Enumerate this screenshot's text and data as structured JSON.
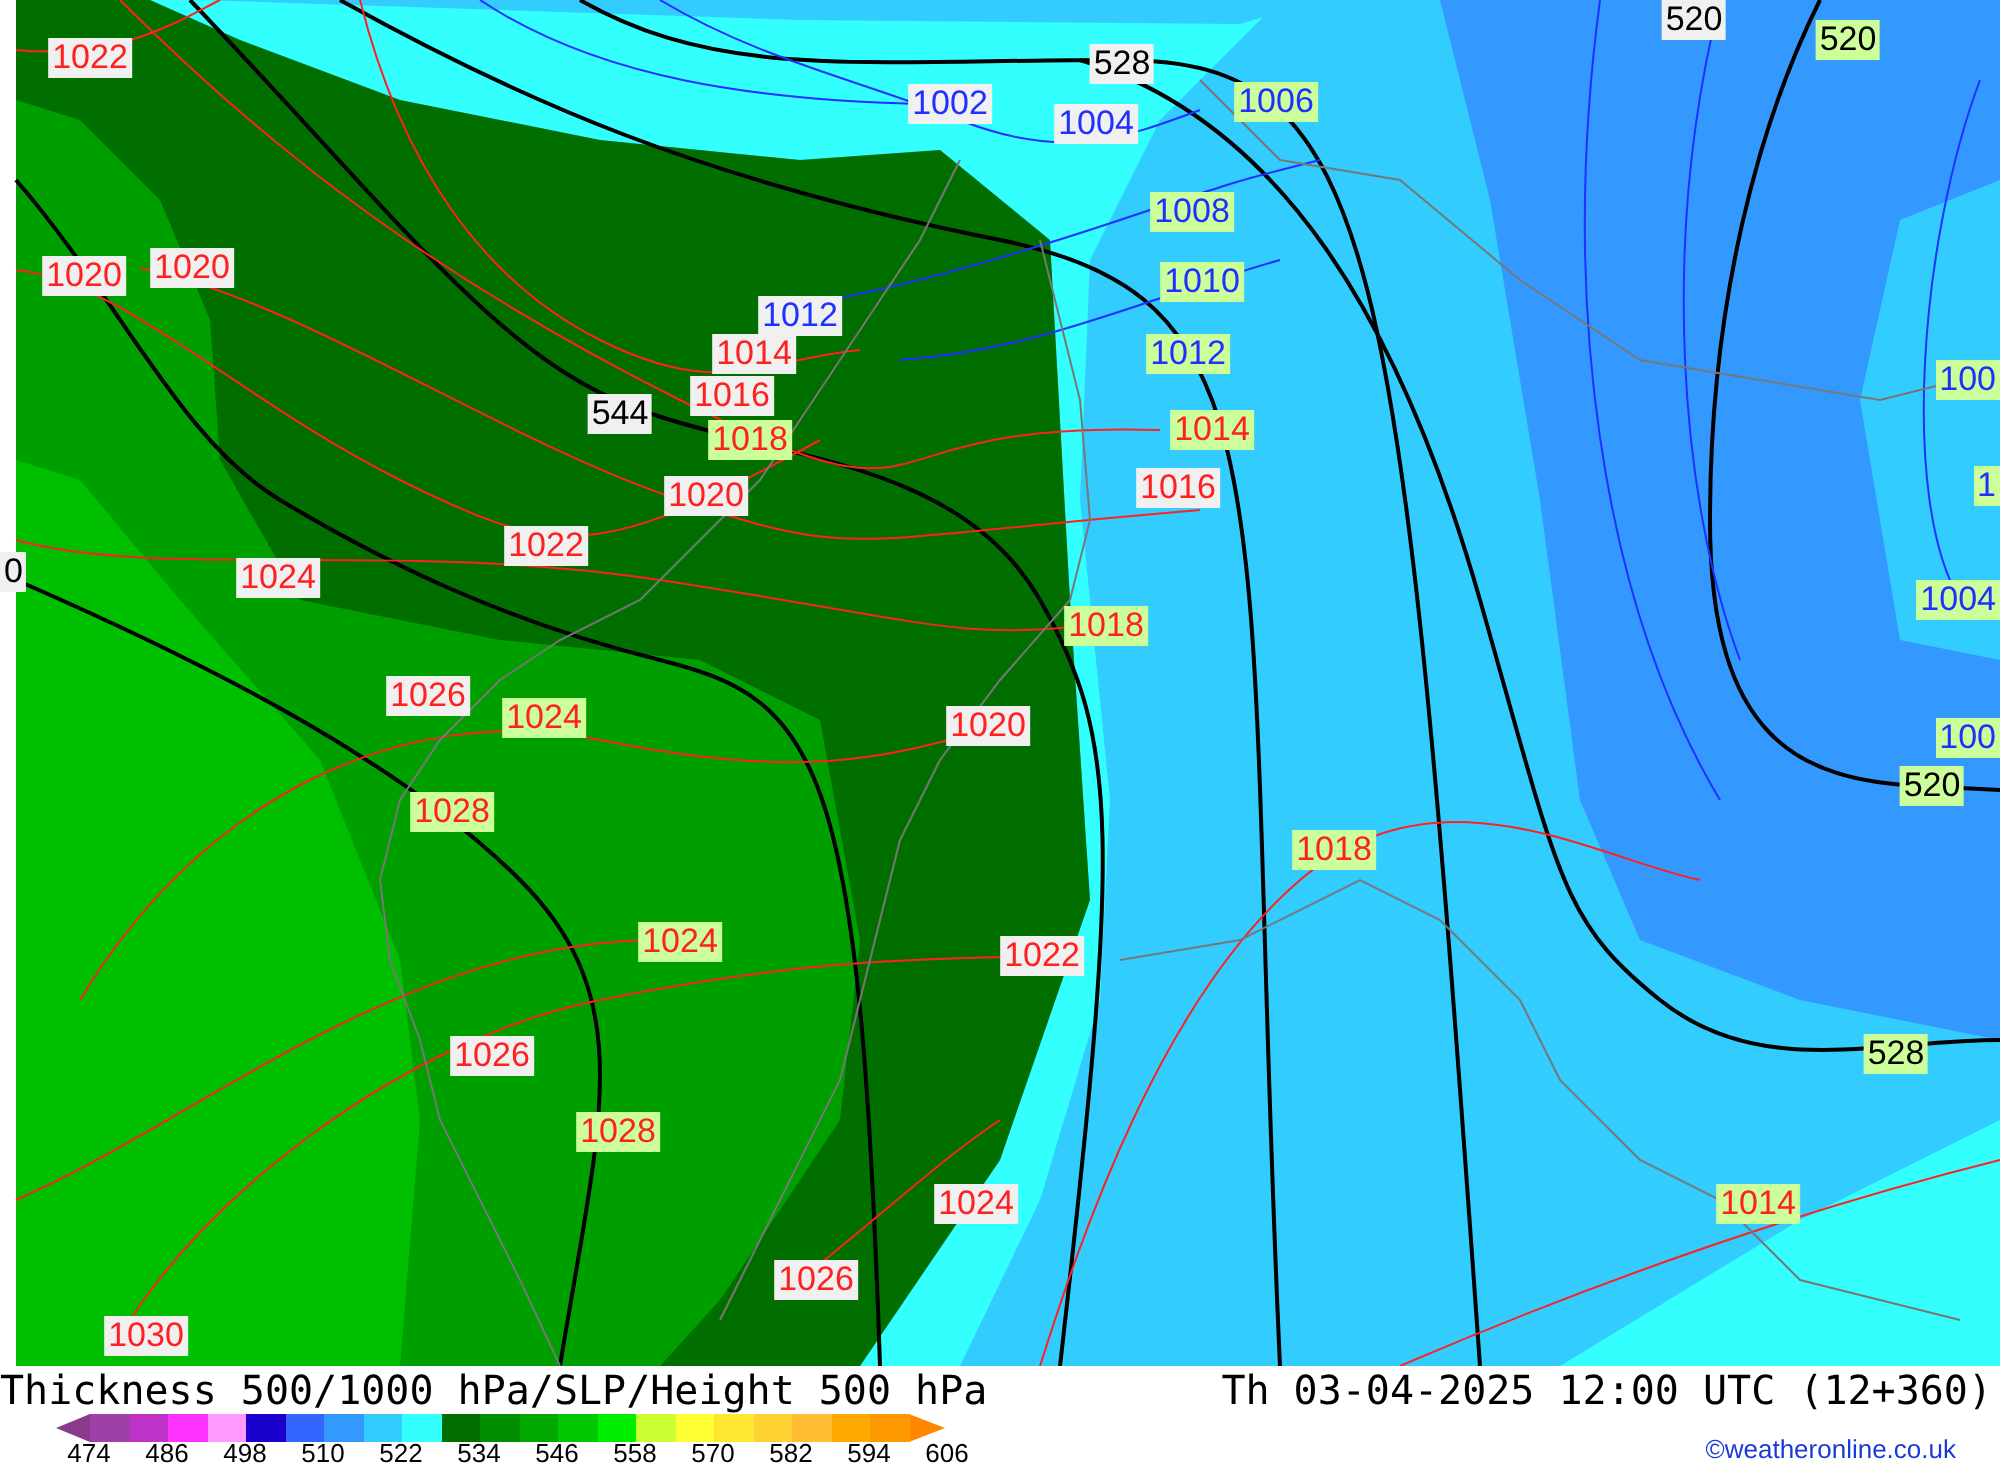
{
  "map": {
    "labels": [
      {
        "text": "520",
        "color": "#000000",
        "highlighted": false
      },
      {
        "text": "520",
        "color": "#000000",
        "highlighted": true
      },
      {
        "text": "1022",
        "color": "#ff2020",
        "highlighted": false
      },
      {
        "text": "528",
        "color": "#000000",
        "highlighted": false
      },
      {
        "text": "1006",
        "color": "#2030ff",
        "highlighted": true
      },
      {
        "text": "1002",
        "color": "#2030ff",
        "highlighted": false
      },
      {
        "text": "1004",
        "color": "#2030ff",
        "highlighted": false
      },
      {
        "text": "1008",
        "color": "#2030ff",
        "highlighted": true
      },
      {
        "text": "1020",
        "color": "#ff2020",
        "highlighted": false
      },
      {
        "text": "1020",
        "color": "#ff2020",
        "highlighted": false
      },
      {
        "text": "1010",
        "color": "#2030ff",
        "highlighted": true
      },
      {
        "text": "1012",
        "color": "#2030ff",
        "highlighted": false
      },
      {
        "text": "1014",
        "color": "#ff2020",
        "highlighted": false
      },
      {
        "text": "1012",
        "color": "#2030ff",
        "highlighted": true
      },
      {
        "text": "100",
        "color": "#2030ff",
        "highlighted": true
      },
      {
        "text": "1016",
        "color": "#ff2020",
        "highlighted": false
      },
      {
        "text": "544",
        "color": "#000000",
        "highlighted": false
      },
      {
        "text": "1014",
        "color": "#ff2020",
        "highlighted": true
      },
      {
        "text": "1018",
        "color": "#ff2020",
        "highlighted": true
      },
      {
        "text": "1016",
        "color": "#ff2020",
        "highlighted": false
      },
      {
        "text": "1",
        "color": "#2030ff",
        "highlighted": true
      },
      {
        "text": "1020",
        "color": "#ff2020",
        "highlighted": false
      },
      {
        "text": "1022",
        "color": "#ff2020",
        "highlighted": false
      },
      {
        "text": "0",
        "color": "#000000",
        "highlighted": false
      },
      {
        "text": "1024",
        "color": "#ff2020",
        "highlighted": false
      },
      {
        "text": "1004",
        "color": "#2030ff",
        "highlighted": true
      },
      {
        "text": "1018",
        "color": "#ff2020",
        "highlighted": true
      },
      {
        "text": "1026",
        "color": "#ff2020",
        "highlighted": false
      },
      {
        "text": "1024",
        "color": "#ff2020",
        "highlighted": true
      },
      {
        "text": "1020",
        "color": "#ff2020",
        "highlighted": false
      },
      {
        "text": "100",
        "color": "#2030ff",
        "highlighted": true
      },
      {
        "text": "520",
        "color": "#000000",
        "highlighted": true
      },
      {
        "text": "1028",
        "color": "#ff2020",
        "highlighted": true
      },
      {
        "text": "1018",
        "color": "#ff2020",
        "highlighted": true
      },
      {
        "text": "1024",
        "color": "#ff2020",
        "highlighted": true
      },
      {
        "text": "1022",
        "color": "#ff2020",
        "highlighted": false
      },
      {
        "text": "528",
        "color": "#000000",
        "highlighted": true
      },
      {
        "text": "1026",
        "color": "#ff2020",
        "highlighted": false
      },
      {
        "text": "1028",
        "color": "#ff2020",
        "highlighted": true
      },
      {
        "text": "1024",
        "color": "#ff2020",
        "highlighted": false
      },
      {
        "text": "1014",
        "color": "#ff2020",
        "highlighted": true
      },
      {
        "text": "1026",
        "color": "#ff2020",
        "highlighted": false
      },
      {
        "text": "1030",
        "color": "#ff2020",
        "highlighted": false
      }
    ]
  },
  "title": "Thickness 500/1000 hPa/SLP/Height 500 hPa",
  "valid_time": "Th 03-04-2025 12:00 UTC (12+360)",
  "legend": {
    "swatches": [
      {
        "color": "#8b3a8b"
      },
      {
        "color": "#9f3fa8"
      },
      {
        "color": "#c033c8"
      },
      {
        "color": "#ff33ff"
      },
      {
        "color": "#ff99ff"
      },
      {
        "color": "#1a00cc"
      },
      {
        "color": "#3366ff"
      },
      {
        "color": "#3399ff"
      },
      {
        "color": "#33ccff"
      },
      {
        "color": "#33ffff"
      },
      {
        "color": "#006f00"
      },
      {
        "color": "#008f00"
      },
      {
        "color": "#00a800"
      },
      {
        "color": "#00c800"
      },
      {
        "color": "#00ee00"
      },
      {
        "color": "#ccff33"
      },
      {
        "color": "#ffff33"
      },
      {
        "color": "#ffe633"
      },
      {
        "color": "#ffd233"
      },
      {
        "color": "#ffbe33"
      },
      {
        "color": "#ffaa00"
      },
      {
        "color": "#ff9900"
      },
      {
        "color": "#ff8800"
      }
    ],
    "labels": [
      "474",
      "486",
      "498",
      "510",
      "522",
      "534",
      "546",
      "558",
      "570",
      "582",
      "594",
      "606"
    ]
  },
  "credit": "©weatheronline.co.uk"
}
